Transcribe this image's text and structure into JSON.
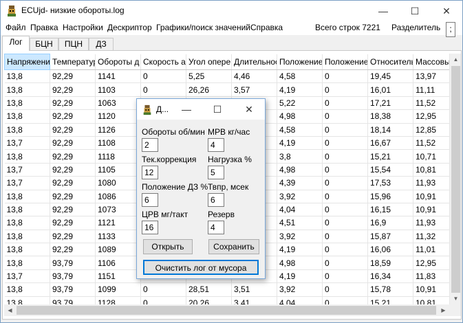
{
  "window": {
    "title": "ECUjd- низкие обороты.log",
    "minimize_glyph": "—",
    "maximize_glyph": "☐",
    "close_glyph": "✕"
  },
  "menu": {
    "items": [
      "Файл",
      "Правка",
      "Настройки",
      "Дескриптор",
      "Графики/поиск значений",
      "Справка"
    ],
    "row_count": "Всего строк 7221",
    "separator_label": "Разделитель",
    "separator_value": ";"
  },
  "tabs": [
    "Лог",
    "БЦН",
    "ПЦН",
    "ДЗ"
  ],
  "table": {
    "columns": [
      "Напряжение",
      "Температура",
      "Обороты д",
      "Скорость а",
      "Угол опере",
      "Длительнос",
      "Положение",
      "Положение",
      "Относитель",
      "Массовый р"
    ],
    "rows": [
      [
        "13,8",
        "92,29",
        "1141",
        "0",
        "5,25",
        "4,46",
        "4,58",
        "0",
        "19,45",
        "13,97"
      ],
      [
        "13,8",
        "92,29",
        "1103",
        "0",
        "26,26",
        "3,57",
        "4,19",
        "0",
        "16,01",
        "11,11"
      ],
      [
        "13,8",
        "92,29",
        "1063",
        "0",
        "28,51",
        "3,87",
        "5,22",
        "0",
        "17,21",
        "11,52"
      ],
      [
        "13,8",
        "92,29",
        "1120",
        "0",
        "",
        "",
        "4,98",
        "0",
        "18,38",
        "12,95"
      ],
      [
        "13,8",
        "92,29",
        "1126",
        "0",
        "",
        "",
        "4,58",
        "0",
        "18,14",
        "12,85"
      ],
      [
        "13,7",
        "92,29",
        "1108",
        "0",
        "",
        "",
        "4,19",
        "0",
        "16,67",
        "11,52"
      ],
      [
        "13,8",
        "92,29",
        "1118",
        "0",
        "",
        "",
        "3,8",
        "0",
        "15,21",
        "10,71"
      ],
      [
        "13,7",
        "92,29",
        "1105",
        "0",
        "",
        "",
        "4,98",
        "0",
        "15,54",
        "10,81"
      ],
      [
        "13,7",
        "92,29",
        "1080",
        "0",
        "",
        "",
        "4,39",
        "0",
        "17,53",
        "11,93"
      ],
      [
        "13,8",
        "92,29",
        "1086",
        "0",
        "",
        "",
        "3,92",
        "0",
        "15,96",
        "10,91"
      ],
      [
        "13,8",
        "92,29",
        "1073",
        "0",
        "",
        "",
        "4,04",
        "0",
        "16,15",
        "10,91"
      ],
      [
        "13,8",
        "92,29",
        "1121",
        "0",
        "",
        "",
        "4,51",
        "0",
        "16,9",
        "11,93"
      ],
      [
        "13,8",
        "92,29",
        "1133",
        "0",
        "",
        "",
        "3,92",
        "0",
        "15,87",
        "11,32"
      ],
      [
        "13,8",
        "92,29",
        "1089",
        "0",
        "",
        "",
        "4,19",
        "0",
        "16,06",
        "11,01"
      ],
      [
        "13,8",
        "93,79",
        "1106",
        "0",
        "",
        "",
        "4,98",
        "0",
        "18,59",
        "12,95"
      ],
      [
        "13,7",
        "93,79",
        "1151",
        "0",
        "",
        "",
        "4,19",
        "0",
        "16,34",
        "11,83"
      ],
      [
        "13,8",
        "93,79",
        "1099",
        "0",
        "28,51",
        "3,51",
        "3,92",
        "0",
        "15,78",
        "10,91"
      ],
      [
        "13,8",
        "93,79",
        "1128",
        "0",
        "20,26",
        "3,41",
        "4,04",
        "0",
        "15,21",
        "10,81"
      ]
    ]
  },
  "dialog": {
    "title": "Д...",
    "minimize_glyph": "—",
    "maximize_glyph": "☐",
    "close_glyph": "✕",
    "fields": [
      {
        "label": "Обороты об/мин",
        "value": "2"
      },
      {
        "label": "МРВ кг/час",
        "value": "4"
      },
      {
        "label": "Тек.коррекция",
        "value": "12"
      },
      {
        "label": "Нагрузка %",
        "value": "5"
      },
      {
        "label": "Положение ДЗ %",
        "value": "6"
      },
      {
        "label": "Твпр, мсек",
        "value": "6"
      },
      {
        "label": "ЦРВ мг/такт",
        "value": "16"
      },
      {
        "label": "Резерв",
        "value": "4"
      }
    ],
    "open_label": "Открыть",
    "save_label": "Сохранить",
    "clear_label": "Очистить лог от мусора"
  },
  "colors": {
    "accent": "#0078d7",
    "selected_header": "#cce8ff"
  }
}
